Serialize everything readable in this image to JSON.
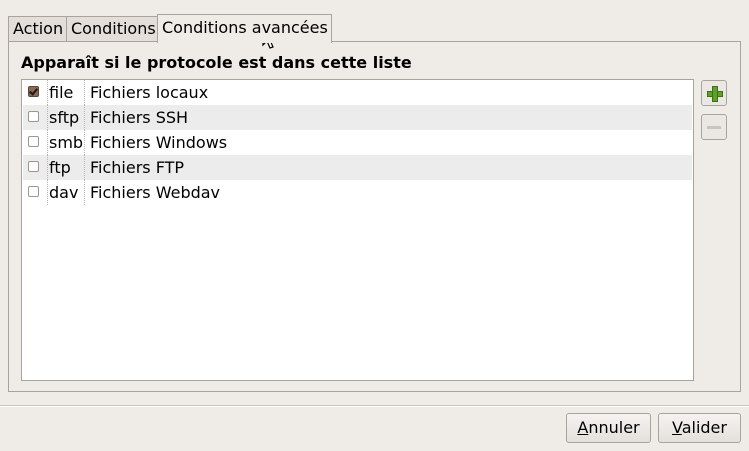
{
  "tabs": [
    {
      "label": "Action"
    },
    {
      "label": "Conditions"
    },
    {
      "label": "Conditions avancées",
      "active": true
    }
  ],
  "panel": {
    "heading": "Apparaît si le protocole est dans cette liste"
  },
  "protocols": [
    {
      "scheme": "file",
      "label": "Fichiers locaux",
      "checked": true
    },
    {
      "scheme": "sftp",
      "label": "Fichiers SSH",
      "checked": false
    },
    {
      "scheme": "smb",
      "label": "Fichiers Windows",
      "checked": false
    },
    {
      "scheme": "ftp",
      "label": "Fichiers FTP",
      "checked": false
    },
    {
      "scheme": "dav",
      "label": "Fichiers Webdav",
      "checked": false
    }
  ],
  "side_buttons": {
    "add_icon": "plus-icon",
    "remove_icon": "minus-icon",
    "remove_enabled": false
  },
  "dialog": {
    "cancel": {
      "mnemonic": "A",
      "rest": "nnuler"
    },
    "ok": {
      "mnemonic": "V",
      "rest": "alider"
    }
  },
  "colors": {
    "background": "#efebe7",
    "alt_row": "#ececec",
    "add_icon": "#5da02c",
    "checkbox_checked": "#8a6a55"
  }
}
